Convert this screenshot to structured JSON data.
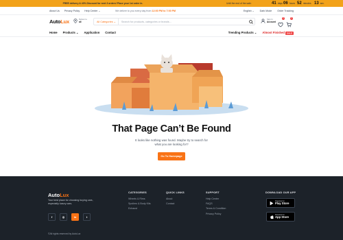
{
  "promo": {
    "message": "FREE delivery & 40% Discount for next 3 orders! Place your 1st order in.",
    "ends_label": "Until the end of the sale:",
    "countdown": [
      {
        "value": "41",
        "unit": "days"
      },
      {
        "value": "06",
        "unit": "hours"
      },
      {
        "value": "52",
        "unit": "minutes"
      },
      {
        "value": "13",
        "unit": "sec."
      }
    ]
  },
  "toplinks": {
    "left": [
      "About Us",
      "Privacy Policy",
      "Help Center ⌄"
    ],
    "mid_text": "We deliver to you every day from ",
    "mid_hours": "12:00 PM to 7:00 PM",
    "right": [
      "English ⌄",
      "Dark Mode",
      "Order Tracking"
    ]
  },
  "header": {
    "logo_a": "Auto",
    "logo_b": "Lux",
    "deliver_label": "Deliver to",
    "deliver_value": "all",
    "search_category": "All Categories",
    "search_placeholder": "Search for products, categories or brands...",
    "account_label": "Sign In",
    "account_value": "Account",
    "wishlist_count": "0",
    "cart_count": "0"
  },
  "nav": {
    "left": [
      "Home",
      "Products ⌄",
      "Application",
      "Contact"
    ],
    "trending": "Trending Products ⌄",
    "almost": "Almost Finished",
    "hot": "SALE"
  },
  "error": {
    "title": "That Page Can’t Be Found",
    "description": "It looks like nothing was found. Maybe try to search for what you are looking for?",
    "button": "Go To Homepage"
  },
  "footer": {
    "logo_a": "Auto",
    "logo_b": "Lux",
    "tagline": "Your best place for choosing buying cars, especially luxury cars.",
    "socials": [
      "f",
      "◎",
      "in",
      "t"
    ],
    "columns": [
      {
        "heading": "CATEGORIES",
        "items": [
          "Wheels & Rims",
          "Spoilers & Body Kits",
          "Exhaust"
        ]
      },
      {
        "heading": "QUICK LINKS",
        "items": [
          "About",
          "Contact"
        ]
      },
      {
        "heading": "SUPPORT",
        "items": [
          "Help Center",
          "FAQS",
          "Terms & Condition",
          "Privacy Policy"
        ]
      }
    ],
    "download_heading": "DOWNLOAD OUR APP",
    "stores": [
      {
        "small": "Download on",
        "big": "Play Store"
      },
      {
        "small": "Download on",
        "big": "App Store"
      }
    ],
    "copyright": "©All rights reserved by AutoLux"
  },
  "colors": {
    "accent": "#f97316",
    "promo_bg": "#f2a21a",
    "footer_bg": "#1c2229",
    "hot": "#ef4444"
  }
}
